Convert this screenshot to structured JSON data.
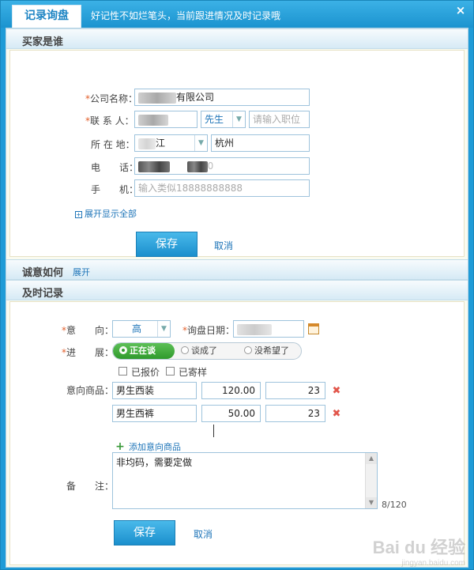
{
  "window": {
    "tab_label": "记录询盘",
    "hint": "好记性不如烂笔头，当前跟进情况及时记录哦",
    "close_glyph": "×"
  },
  "buyer_section": {
    "title": "买家是谁",
    "company": {
      "label": "公司名称：",
      "value_suffix": "有限公司"
    },
    "contact": {
      "label": "联 系 人：",
      "title_value": "先生",
      "position_placeholder": "请输入职位"
    },
    "location": {
      "label": "所 在 地：",
      "province_partial": "江",
      "city": "杭州"
    },
    "phone": {
      "label": "电　　话：",
      "value_partial": "0"
    },
    "mobile": {
      "label": "手　　机：",
      "placeholder": "输入类似18888888888"
    },
    "expand_all": "展开显示全部",
    "save_label": "保存",
    "cancel_label": "取消"
  },
  "intent_section": {
    "title": "诚意如何",
    "expand_label": "展开"
  },
  "record_section": {
    "title": "及时记录",
    "intention": {
      "label": "意　　向：",
      "value": "高"
    },
    "inquiry_date": {
      "label": "询盘日期："
    },
    "progress": {
      "label": "进　　展：",
      "options": [
        "正在谈",
        "谈成了",
        "没希望了"
      ],
      "active_index": 0
    },
    "checkboxes": [
      "已报价",
      "已寄样"
    ],
    "products_label": "意向商品：",
    "products": [
      {
        "name": "男生西装",
        "price": "120.00",
        "qty": "23"
      },
      {
        "name": "男生西裤",
        "price": "50.00",
        "qty": "23"
      }
    ],
    "add_product": "添加意向商品",
    "notes": {
      "label": "备　　注：",
      "value": "非均码，需要定做",
      "counter": "8/120"
    },
    "save_label": "保存",
    "cancel_label": "取消"
  },
  "watermark": {
    "logo": "Bai du 经验",
    "sub": "jingyan.baidu.com"
  },
  "colors": {
    "accent": "#1f9bd7",
    "button": "#2aa3dc",
    "required": "#e35f2b",
    "link": "#1d74b8",
    "active_toggle": "#3ba836"
  }
}
